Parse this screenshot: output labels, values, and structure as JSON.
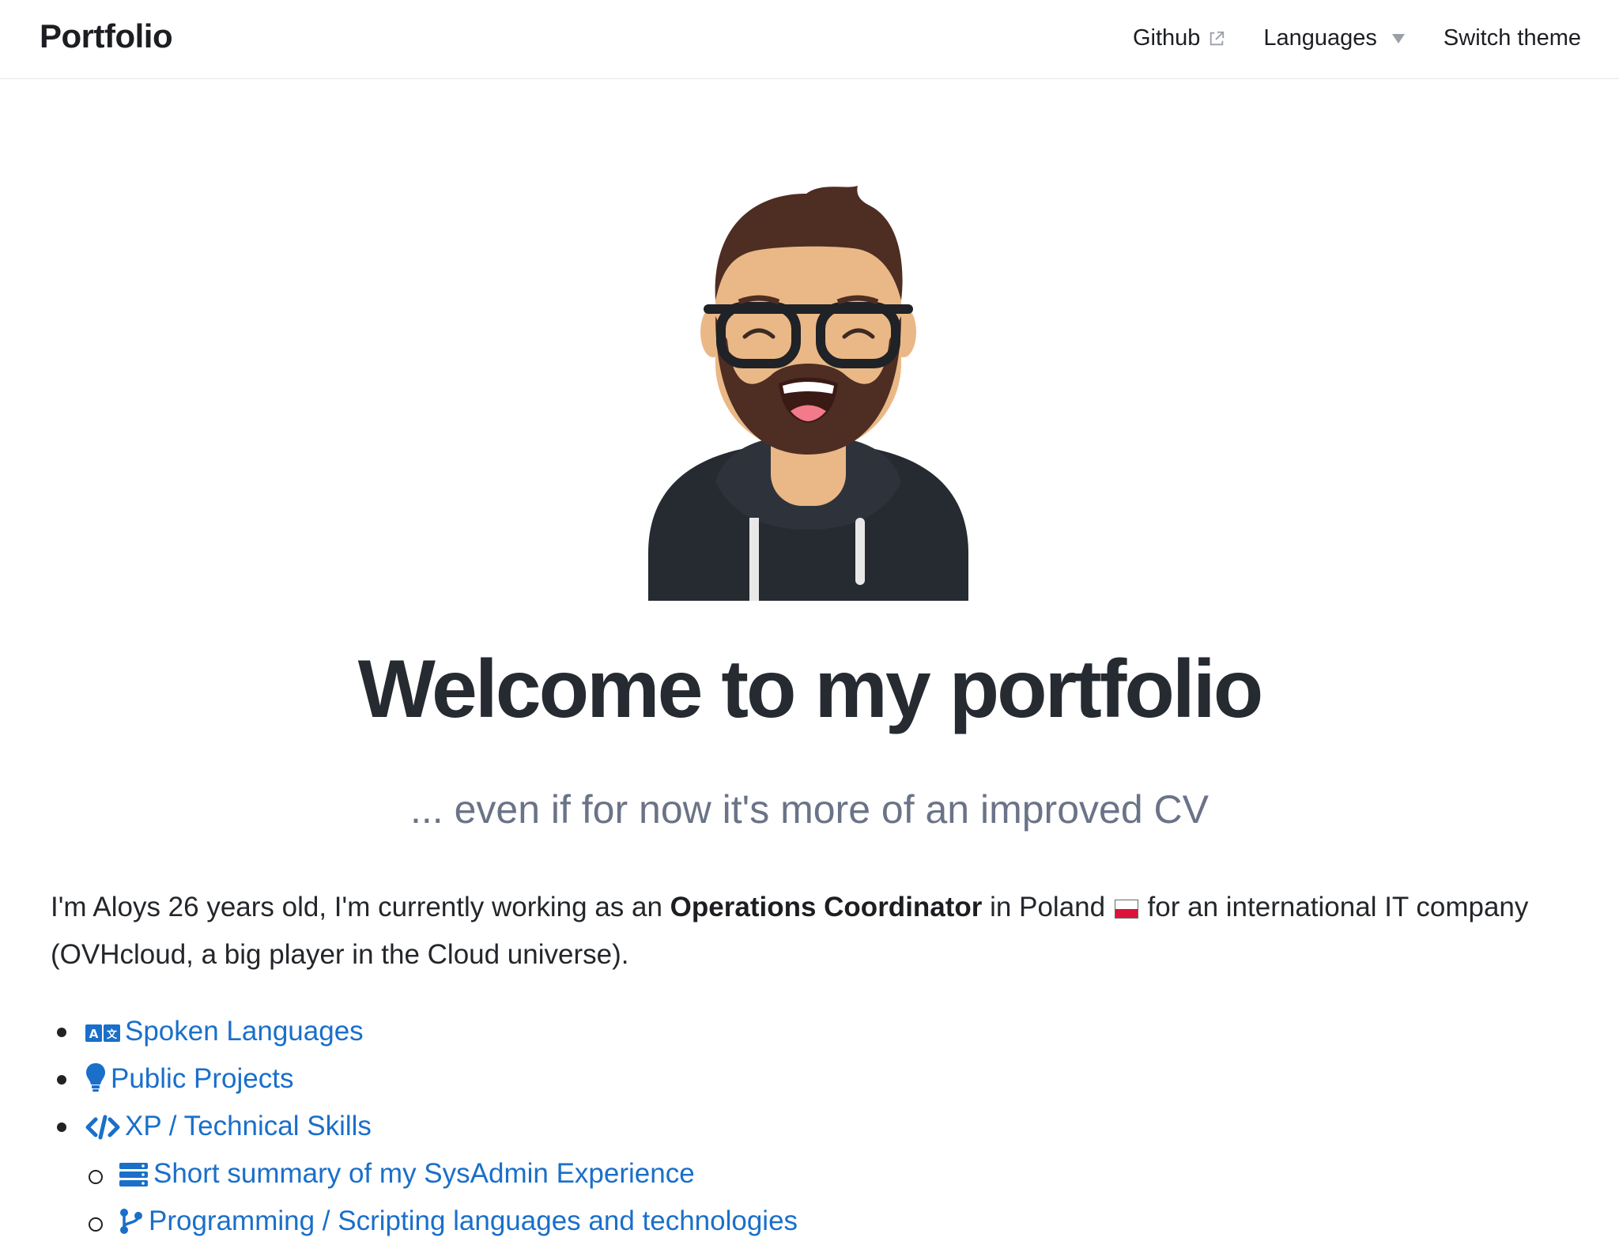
{
  "navbar": {
    "brand": "Portfolio",
    "github_label": "Github",
    "languages_label": "Languages",
    "theme_label": "Switch theme"
  },
  "hero": {
    "title": "Welcome to my portfolio",
    "subtitle": "... even if for now it's more of an improved CV"
  },
  "intro": {
    "part1": "I'm Aloys 26 years old, I'm currently working as an ",
    "role": "Operations Coordinator",
    "part2": " in Poland ",
    "part3": " for an international IT company (OVHcloud, a big player in the Cloud universe)."
  },
  "links": [
    {
      "label": "Spoken Languages",
      "icon": "translate-icon"
    },
    {
      "label": "Public Projects",
      "icon": "lightbulb-icon"
    },
    {
      "label": "XP / Technical Skills",
      "icon": "code-icon"
    },
    {
      "label": "Short summary of my SysAdmin Experience",
      "icon": "server-icon"
    },
    {
      "label": "Programming / Scripting languages and technologies",
      "icon": "code-branch-icon"
    }
  ],
  "colors": {
    "link": "#1a6fc9",
    "subtitle": "#6a7387",
    "title": "#262a31"
  }
}
